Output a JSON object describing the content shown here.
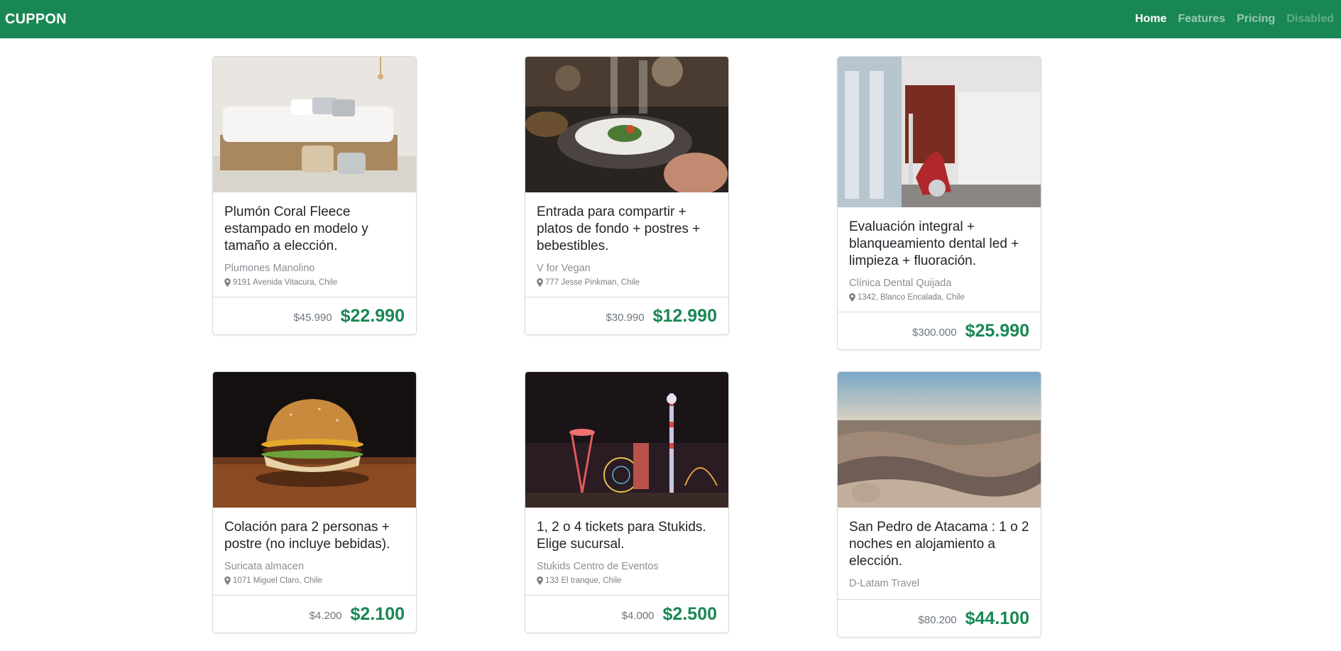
{
  "navbar": {
    "brand": "CUPPON",
    "links": [
      {
        "label": "Home",
        "state": "active"
      },
      {
        "label": "Features",
        "state": "normal"
      },
      {
        "label": "Pricing",
        "state": "normal"
      },
      {
        "label": "Disabled",
        "state": "disabled"
      }
    ]
  },
  "colors": {
    "primary": "#198754",
    "price": "#198754"
  },
  "cards": [
    {
      "image": "bedroom-photo",
      "title": "Plumón Coral Fleece estampado en modelo y tamaño a elección.",
      "merchant": "Plumones Manolino",
      "location": "9191 Avenida Vitacura, Chile",
      "old_price": "$45.990",
      "price": "$22.990"
    },
    {
      "image": "restaurant-dinner-photo",
      "title": "Entrada para compartir + platos de fondo + postres + bebestibles.",
      "merchant": "V for Vegan",
      "location": "777 Jesse Pinkman, Chile",
      "old_price": "$30.990",
      "price": "$12.990"
    },
    {
      "image": "dental-clinic-photo",
      "title": "Evaluación integral + blanqueamiento dental led + limpieza + fluoración.",
      "merchant": "Clínica Dental Quijada",
      "location": "1342, Blanco Encalada, Chile",
      "old_price": "$300.000",
      "price": "$25.990"
    },
    {
      "image": "burger-photo",
      "title": "Colación para 2 personas + postre (no incluye bebidas).",
      "merchant": "Suricata almacen",
      "location": "1071 Miguel Claro, Chile",
      "old_price": "$4.200",
      "price": "$2.100"
    },
    {
      "image": "amusement-park-night-photo",
      "title": "1, 2 o 4 tickets para Stukids. Elige sucursal.",
      "merchant": "Stukids Centro de Eventos",
      "location": "133 El tranque, Chile",
      "old_price": "$4.000",
      "price": "$2.500"
    },
    {
      "image": "atacama-desert-photo",
      "title": "San Pedro de Atacama : 1 o 2 noches en alojamiento a elección.",
      "merchant": "D-Latam Travel",
      "location": "",
      "old_price": "$80.200",
      "price": "$44.100"
    }
  ]
}
